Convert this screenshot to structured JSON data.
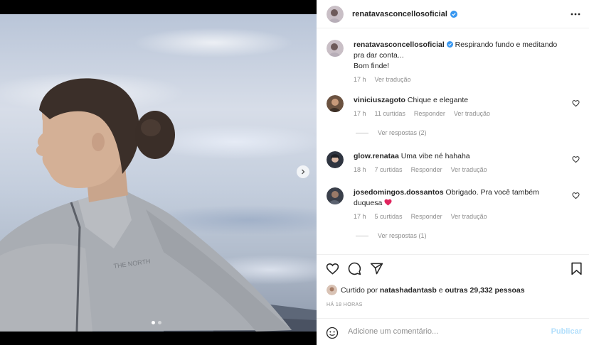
{
  "post": {
    "username": "renatavasconcellosoficial",
    "caption_text": "Respirando fundo e meditando pra dar conta...",
    "caption_line2": "Bom finde!",
    "caption_time": "17 h",
    "caption_translate": "Ver tradução"
  },
  "comments": [
    {
      "username": "viniciuszagoto",
      "text": "Chique e elegante",
      "time": "17 h",
      "likes": "11 curtidas",
      "reply": "Responder",
      "translate": "Ver tradução",
      "view_replies": "Ver respostas (2)"
    },
    {
      "username": "glow.renataa",
      "text": "Uma vibe né hahaha",
      "time": "18 h",
      "likes": "7 curtidas",
      "reply": "Responder",
      "translate": "Ver tradução"
    },
    {
      "username": "josedomingos.dossantos",
      "text": "Obrigado. Pra você também duquesa",
      "time": "17 h",
      "likes": "5 curtidas",
      "reply": "Responder",
      "translate": "Ver tradução",
      "view_replies": "Ver respostas (1)"
    }
  ],
  "likes": {
    "prefix": "Curtido por",
    "user": "natashadantasb",
    "connector": "e",
    "others": "outras 29,332 pessoas"
  },
  "post_time": "HÁ 18 HORAS",
  "add_comment": {
    "placeholder": "Adicione um comentário...",
    "publish_label": "Publicar"
  },
  "colors": {
    "verified": "#3897f0",
    "link_disabled": "#b2dffc",
    "muted": "#8e8e8e",
    "heart_emoji": "#e0245e"
  },
  "icons": [
    "verified-icon",
    "more-options-icon",
    "heart-icon",
    "comment-icon",
    "share-icon",
    "bookmark-icon",
    "emoji-icon",
    "next-arrow-icon"
  ],
  "carousel": {
    "total_slides": 2,
    "active_slide": 1
  }
}
